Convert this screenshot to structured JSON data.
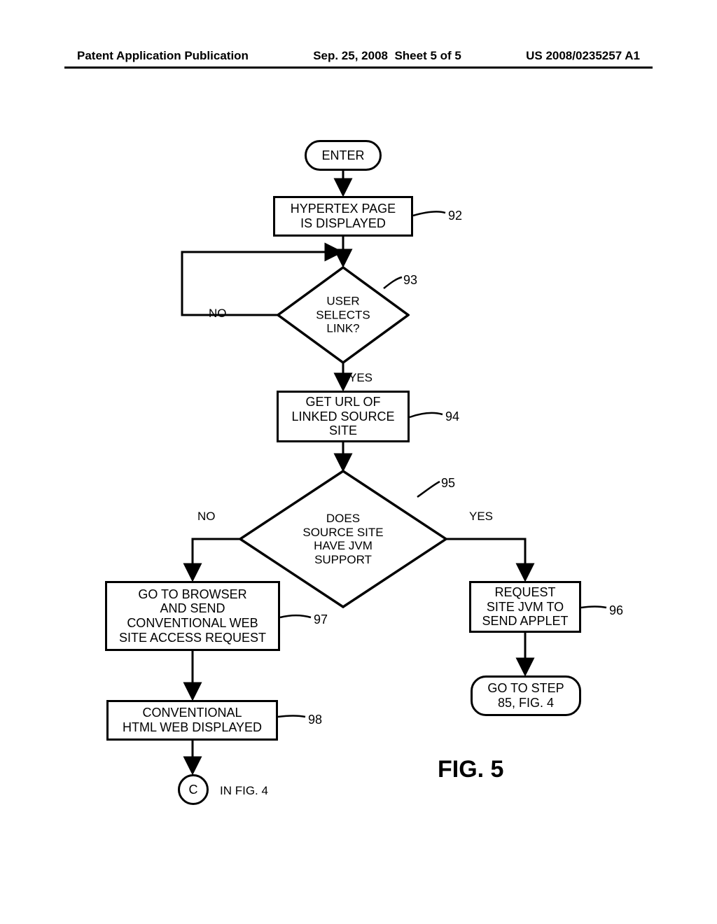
{
  "header": {
    "left": "Patent Application Publication",
    "date": "Sep. 25, 2008",
    "sheet": "Sheet 5 of 5",
    "pubno": "US 2008/0235257 A1"
  },
  "nodes": {
    "enter": "ENTER",
    "n92": "HYPERTEX PAGE\nIS DISPLAYED",
    "n93": "USER\nSELECTS\nLINK?",
    "n94": "GET URL OF\nLINKED SOURCE\nSITE",
    "n95": "DOES\nSOURCE SITE\nHAVE JVM\nSUPPORT",
    "n96": "REQUEST\nSITE JVM TO\nSEND APPLET",
    "n97": "GO TO BROWSER\nAND SEND\nCONVENTIONAL WEB\nSITE ACCESS REQUEST",
    "n98": "CONVENTIONAL\nHTML WEB DISPLAYED",
    "goto85": "GO TO STEP\n85, FIG. 4",
    "connC": "C",
    "connC_note": "IN FIG. 4"
  },
  "labels": {
    "no": "NO",
    "yes": "YES"
  },
  "refs": {
    "r92": "92",
    "r93": "93",
    "r94": "94",
    "r95": "95",
    "r96": "96",
    "r97": "97",
    "r98": "98"
  },
  "figure": "FIG. 5"
}
